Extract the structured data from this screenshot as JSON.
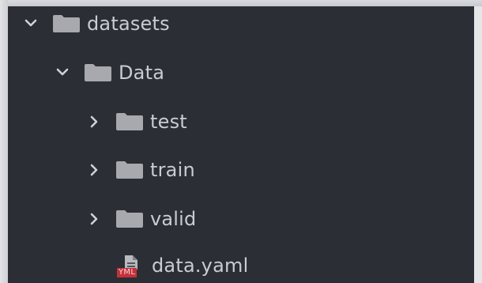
{
  "explorer": {
    "items": [
      {
        "label": "datasets",
        "icon": "folder-icon",
        "expanded": true,
        "depth": 0
      },
      {
        "label": "Data",
        "icon": "folder-icon",
        "expanded": true,
        "depth": 1
      },
      {
        "label": "test",
        "icon": "folder-icon",
        "expanded": false,
        "depth": 2
      },
      {
        "label": "train",
        "icon": "folder-icon",
        "expanded": false,
        "depth": 2
      },
      {
        "label": "valid",
        "icon": "folder-icon",
        "expanded": false,
        "depth": 2
      },
      {
        "label": "data.yaml",
        "icon": "yaml-file-icon",
        "badge": "YML",
        "depth": 2
      }
    ]
  },
  "colors": {
    "panel_bg": "#2b2e35",
    "text": "#c9ccd2",
    "folder": "#a7a9ae",
    "yml_badge": "#c4313b"
  }
}
